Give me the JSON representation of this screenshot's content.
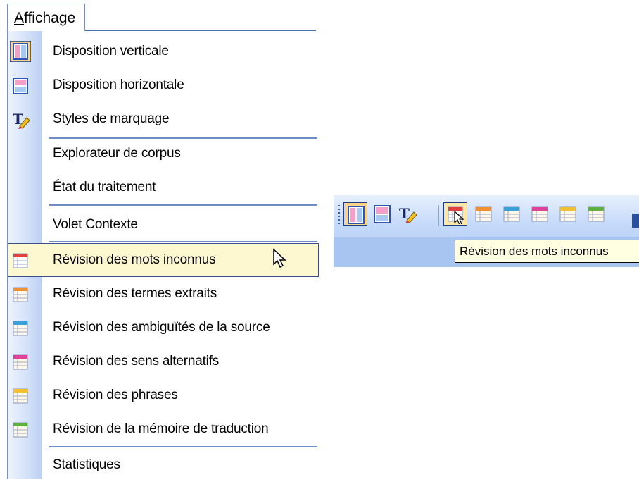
{
  "menu": {
    "title": "Affichage",
    "accelerator": "A",
    "title_rest": "ffichage",
    "items": [
      {
        "label": "Disposition verticale",
        "icon": "vertical-layout-icon"
      },
      {
        "label": "Disposition horizontale",
        "icon": "horizontal-layout-icon"
      },
      {
        "label": "Styles de marquage",
        "icon": "markup-styles-icon"
      },
      {
        "label": "Explorateur de corpus",
        "icon": ""
      },
      {
        "label": "État du traitement",
        "icon": ""
      },
      {
        "label": "Volet Contexte",
        "icon": ""
      },
      {
        "label": "Révision des mots inconnus",
        "icon": "review-grid-icon",
        "accent": "#e04040",
        "highlighted": true
      },
      {
        "label": "Révision des termes extraits",
        "icon": "review-grid-icon",
        "accent": "#f09030"
      },
      {
        "label": "Révision des ambiguïtés de la source",
        "icon": "review-grid-icon",
        "accent": "#3aa0d8"
      },
      {
        "label": "Révision des sens alternatifs",
        "icon": "review-grid-icon",
        "accent": "#e0409a"
      },
      {
        "label": "Révision des phrases",
        "icon": "review-grid-icon",
        "accent": "#f0c030"
      },
      {
        "label": "Révision de la mémoire de traduction",
        "icon": "review-grid-icon",
        "accent": "#60b040"
      },
      {
        "label": "Statistiques",
        "icon": ""
      }
    ]
  },
  "toolbar": {
    "buttons": [
      {
        "name": "vertical-layout",
        "icon": "vertical-layout-icon",
        "state": "active"
      },
      {
        "name": "horizontal-layout",
        "icon": "horizontal-layout-icon",
        "state": "normal"
      },
      {
        "name": "markup-styles",
        "icon": "markup-styles-icon",
        "state": "normal"
      },
      {
        "name": "review-unknown-words",
        "icon": "review-grid-icon",
        "accent": "#e04040",
        "state": "hover"
      },
      {
        "name": "review-extracted-terms",
        "icon": "review-grid-icon",
        "accent": "#f09030",
        "state": "normal"
      },
      {
        "name": "review-source-ambiguities",
        "icon": "review-grid-icon",
        "accent": "#3aa0d8",
        "state": "normal"
      },
      {
        "name": "review-alternative-senses",
        "icon": "review-grid-icon",
        "accent": "#e0409a",
        "state": "normal"
      },
      {
        "name": "review-sentences",
        "icon": "review-grid-icon",
        "accent": "#f0c030",
        "state": "normal"
      },
      {
        "name": "review-translation-memory",
        "icon": "review-grid-icon",
        "accent": "#60b040",
        "state": "normal"
      }
    ],
    "tooltip": "Révision des mots inconnus"
  },
  "colors": {
    "menu_gutter": "#bcd0f2",
    "highlight_bg": "#fdf8cf",
    "highlight_border": "#3b4d8c",
    "separator": "#6f8dc4",
    "tooltip_bg": "#ffffe1"
  }
}
